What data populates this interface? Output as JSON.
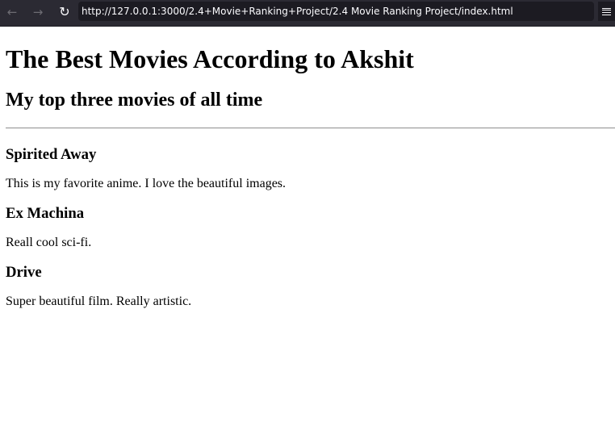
{
  "browser": {
    "back_icon": "arrow-left-icon",
    "forward_icon": "arrow-right-icon",
    "reload_icon": "reload-icon",
    "menu_icon": "hamburger-menu-icon",
    "url": "http://127.0.0.1:3000/2.4+Movie+Ranking+Project/2.4 Movie Ranking Project/index.html",
    "colors": {
      "toolbar_bg": "#2b2a33",
      "url_bg": "#1c1b22",
      "text": "#fbfbfe"
    }
  },
  "page": {
    "title": "The Best Movies According to Akshit",
    "subtitle": "My top three movies of all time",
    "movies": [
      {
        "title": "Spirited Away",
        "description": "This is my favorite anime. I love the beautiful images."
      },
      {
        "title": "Ex Machina",
        "description": "Reall cool sci-fi."
      },
      {
        "title": "Drive",
        "description": "Super beautiful film. Really artistic."
      }
    ]
  }
}
